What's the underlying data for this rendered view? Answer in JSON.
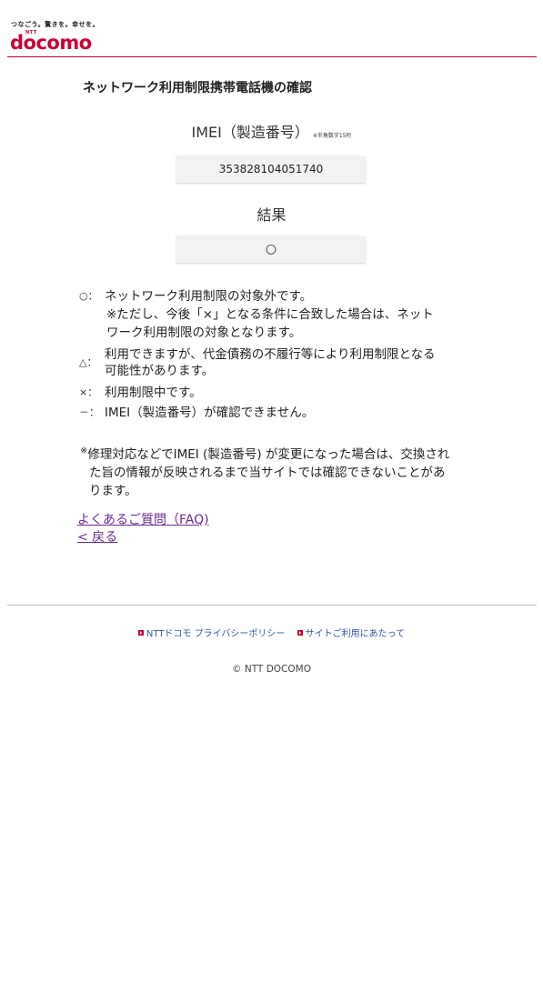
{
  "header": {
    "tagline": "つなごう。驚きを。幸せを。",
    "logo_small": "NTT",
    "logo": "docomo"
  },
  "page_title": "ネットワーク利用制限携帯電話機の確認",
  "imei": {
    "label": "IMEI（製造番号）",
    "note": "※半角数字15桁",
    "value": "353828104051740"
  },
  "result": {
    "label": "結果",
    "value": "○"
  },
  "legend": {
    "circle": {
      "symbol": "○",
      "colon": "：",
      "text": "ネットワーク利用制限の対象外です。",
      "sub1": "※ただし、今後「×」となる条件に合致した場合は、ネット",
      "sub2": "ワーク利用制限の対象となります。"
    },
    "triangle": {
      "symbol": "△",
      "colon": "：",
      "text1": "利用できますが、代金債務の不履行等により利用制限となる",
      "text2": "可能性があります。"
    },
    "cross": {
      "symbol": "×",
      "colon": "：",
      "text": "利用制限中です。"
    },
    "dash": {
      "symbol": "－",
      "colon": "：",
      "text": "IMEI（製造番号）が確認できません。"
    }
  },
  "note": {
    "mark": "※",
    "line1": "修理対応などでIMEI (製造番号) が変更になった場合は、交換され",
    "line2": "た旨の情報が反映されるまで当サイトでは確認できないことがあ",
    "line3": "ります。"
  },
  "links": {
    "faq": "よくあるご質問（FAQ)",
    "back": "< 戻る"
  },
  "footer": {
    "privacy": "NTTドコモ プライバシーポリシー",
    "terms": "サイトご利用にあたって",
    "copyright": "© NTT DOCOMO"
  },
  "colors": {
    "brand": "#cc0033",
    "link": "#6a2c91",
    "footer_link": "#2f5aa0"
  }
}
